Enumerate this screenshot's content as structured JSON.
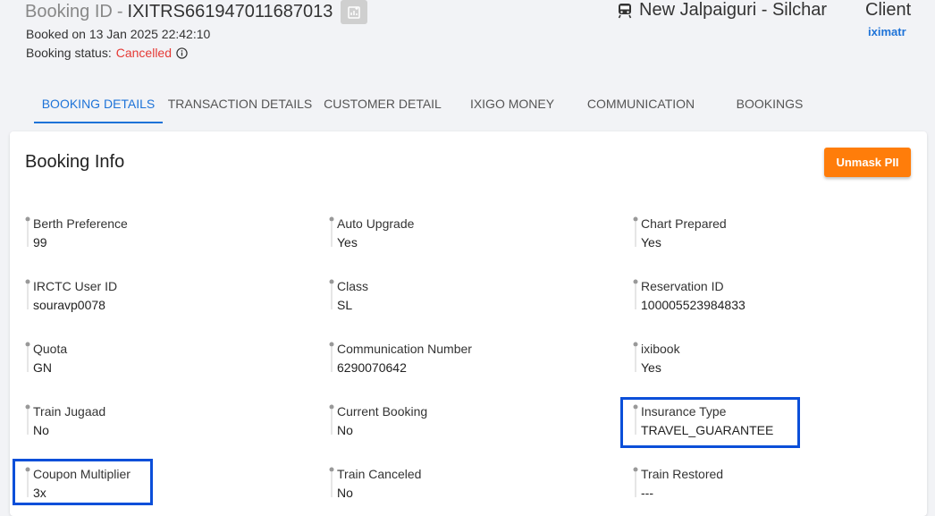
{
  "header": {
    "booking_id_label": "Booking ID",
    "booking_id_sep": "-",
    "booking_id": "IXITRS661947011687013",
    "booked_on": "Booked on 13 Jan 2025 22:42:10",
    "booking_status_label": "Booking status:",
    "booking_status": "Cancelled",
    "route": "New Jalpaiguri - Silchar",
    "client_label": "Client",
    "client_user": "iximatr"
  },
  "tabs": [
    {
      "label": "BOOKING DETAILS",
      "active": true
    },
    {
      "label": "TRANSACTION DETAILS",
      "active": false
    },
    {
      "label": "CUSTOMER DETAIL",
      "active": false
    },
    {
      "label": "IXIGO MONEY",
      "active": false
    },
    {
      "label": "COMMUNICATION",
      "active": false
    },
    {
      "label": "BOOKINGS",
      "active": false
    }
  ],
  "card": {
    "title": "Booking Info",
    "unmask_label": "Unmask PII"
  },
  "fields": [
    {
      "label": "Berth Preference",
      "value": "99"
    },
    {
      "label": "Auto Upgrade",
      "value": "Yes"
    },
    {
      "label": "Chart Prepared",
      "value": "Yes"
    },
    {
      "label": "IRCTC User ID",
      "value": "souravp0078"
    },
    {
      "label": "Class",
      "value": "SL"
    },
    {
      "label": "Reservation ID",
      "value": "100005523984833"
    },
    {
      "label": "Quota",
      "value": "GN"
    },
    {
      "label": "Communication Number",
      "value": "6290070642"
    },
    {
      "label": "ixibook",
      "value": "Yes"
    },
    {
      "label": "Train Jugaad",
      "value": "No"
    },
    {
      "label": "Current Booking",
      "value": "No"
    },
    {
      "label": "Insurance Type",
      "value": "TRAVEL_GUARANTEE"
    },
    {
      "label": "Coupon Multiplier",
      "value": "3x"
    },
    {
      "label": "Train Canceled",
      "value": "No"
    },
    {
      "label": "Train Restored",
      "value": "---"
    }
  ],
  "colors": {
    "accent": "#1e73d8",
    "status_cancelled": "#e53935",
    "unmask_button": "#ff7d0a",
    "highlight_box": "#0b4fd9"
  },
  "icons": [
    "copy-icon",
    "info-icon",
    "train-icon",
    "pin-icon"
  ]
}
